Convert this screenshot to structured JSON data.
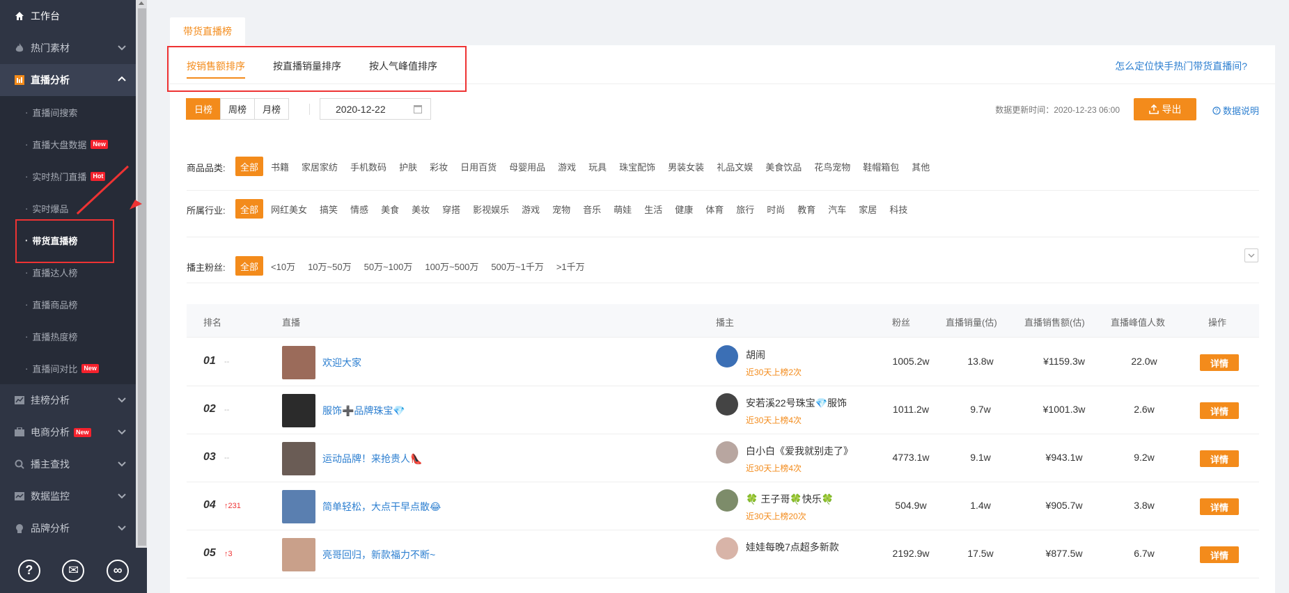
{
  "sidebar": {
    "workbench": "工作台",
    "hot_material": "热门素材",
    "live_analysis": "直播分析",
    "sub_items": [
      {
        "label": "直播间搜索",
        "badge": ""
      },
      {
        "label": "直播大盘数据",
        "badge": "New"
      },
      {
        "label": "实时热门直播",
        "badge": "Hot"
      },
      {
        "label": "实时爆品",
        "badge": ""
      },
      {
        "label": "带货直播榜",
        "badge": ""
      },
      {
        "label": "直播达人榜",
        "badge": ""
      },
      {
        "label": "直播商品榜",
        "badge": ""
      },
      {
        "label": "直播热度榜",
        "badge": ""
      },
      {
        "label": "直播间对比",
        "badge": "New"
      }
    ],
    "bottom_items": [
      {
        "label": "挂榜分析",
        "badge": ""
      },
      {
        "label": "电商分析",
        "badge": "New"
      },
      {
        "label": "播主查找",
        "badge": ""
      },
      {
        "label": "数据监控",
        "badge": ""
      },
      {
        "label": "品牌分析",
        "badge": ""
      }
    ],
    "footer": {
      "help": "?",
      "wechat": "✉",
      "link": "∞"
    }
  },
  "page_tab": "带货直播榜",
  "sort_tabs": [
    "按销售额排序",
    "按直播销量排序",
    "按人气峰值排序"
  ],
  "help_link": "怎么定位快手热门带货直播间?",
  "period": [
    "日榜",
    "周榜",
    "月榜"
  ],
  "date": "2020-12-22",
  "update_time": "数据更新时间：2020-12-23 06:00",
  "export_label": "导出",
  "data_desc": "数据说明",
  "filters": {
    "category": {
      "label": "商品品类:",
      "options": [
        "全部",
        "书籍",
        "家居家纺",
        "手机数码",
        "护肤",
        "彩妆",
        "日用百货",
        "母婴用品",
        "游戏",
        "玩具",
        "珠宝配饰",
        "男装女装",
        "礼品文娱",
        "美食饮品",
        "花鸟宠物",
        "鞋帽箱包",
        "其他"
      ]
    },
    "industry": {
      "label": "所属行业:",
      "options": [
        "全部",
        "网红美女",
        "搞笑",
        "情感",
        "美食",
        "美妆",
        "穿搭",
        "影视娱乐",
        "游戏",
        "宠物",
        "音乐",
        "萌娃",
        "生活",
        "健康",
        "体育",
        "旅行",
        "时尚",
        "教育",
        "汽车",
        "家居",
        "科技"
      ]
    },
    "fans": {
      "label": "播主粉丝:",
      "options": [
        "全部",
        "<10万",
        "10万~50万",
        "50万~100万",
        "100万~500万",
        "500万~1千万",
        ">1千万"
      ]
    }
  },
  "table": {
    "headers": [
      "排名",
      "直播",
      "播主",
      "粉丝",
      "直播销量(估)",
      "直播销售额(估)",
      "直播峰值人数",
      "操作"
    ],
    "rows": [
      {
        "rank": "01",
        "change": "--",
        "title": "欢迎大家",
        "anchor": "胡闹",
        "sub": "近30天上榜2次",
        "fans": "1005.2w",
        "sales": "13.8w",
        "revenue": "¥1159.3w",
        "peak": "22.0w",
        "action": "详情",
        "thumb_color": "#9b6b5a",
        "avatar_color": "#3b6fb5"
      },
      {
        "rank": "02",
        "change": "--",
        "title": "服饰➕品牌珠宝💎",
        "anchor": "安若溪22号珠宝💎服饰",
        "sub": "近30天上榜4次",
        "fans": "1011.2w",
        "sales": "9.7w",
        "revenue": "¥1001.3w",
        "peak": "2.6w",
        "action": "详情",
        "thumb_color": "#2b2b2b",
        "avatar_color": "#444"
      },
      {
        "rank": "03",
        "change": "--",
        "title": "运动品牌！来抢贵人👠",
        "anchor": "白小白《爱我就别走了》",
        "sub": "近30天上榜4次",
        "fans": "4773.1w",
        "sales": "9.1w",
        "revenue": "¥943.1w",
        "peak": "9.2w",
        "action": "详情",
        "thumb_color": "#6a5c55",
        "avatar_color": "#b8a6a0"
      },
      {
        "rank": "04",
        "change": "↑231",
        "title": "简单轻松，大点干早点散😂",
        "anchor": "🍀 王子哥🍀快乐🍀",
        "sub": "近30天上榜20次",
        "fans": "504.9w",
        "sales": "1.4w",
        "revenue": "¥905.7w",
        "peak": "3.8w",
        "action": "详情",
        "thumb_color": "#5a7fb0",
        "avatar_color": "#7d8c6a"
      },
      {
        "rank": "05",
        "change": "↑3",
        "title": "亮哥回归，新款福力不断~",
        "anchor": "娃娃每晚7点超多新款",
        "sub": "",
        "fans": "2192.9w",
        "sales": "17.5w",
        "revenue": "¥877.5w",
        "peak": "6.7w",
        "action": "详情",
        "thumb_color": "#c9a08a",
        "avatar_color": "#d8b4a8"
      }
    ]
  },
  "colors": {
    "accent": "#f38b1b",
    "link": "#2d7fd0",
    "sidebar": "#2f3544",
    "highlight": "#e33"
  }
}
